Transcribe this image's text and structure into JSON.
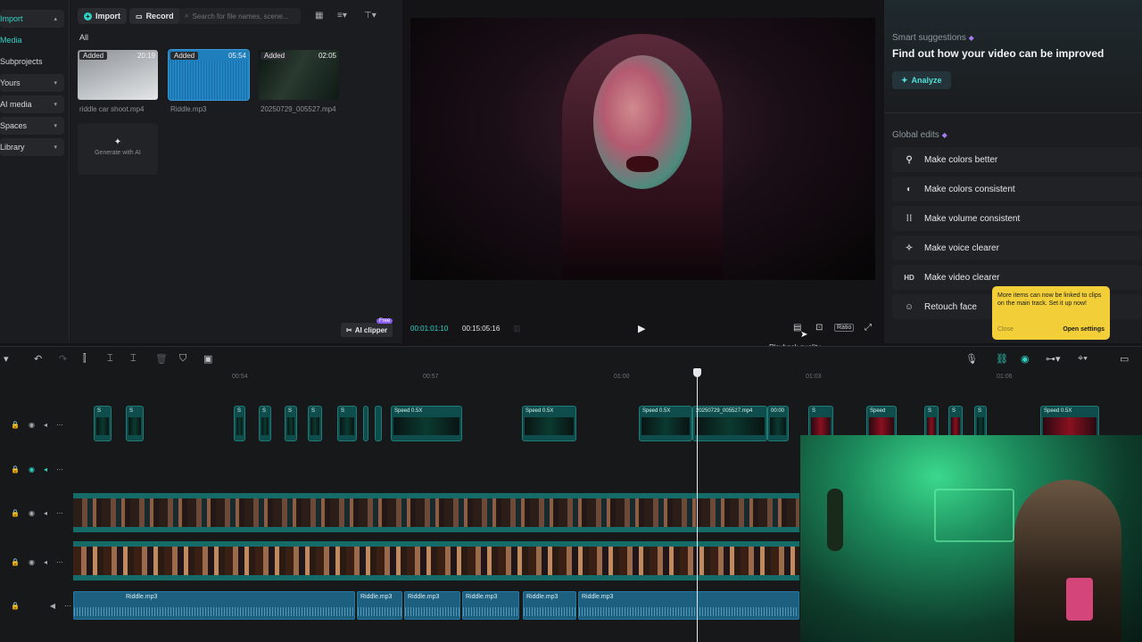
{
  "nav": {
    "items": [
      {
        "label": "Import"
      },
      {
        "label": "Media"
      },
      {
        "label": "Subprojects"
      },
      {
        "label": "Yours"
      },
      {
        "label": "AI media"
      },
      {
        "label": "Spaces"
      },
      {
        "label": "Library"
      }
    ]
  },
  "media": {
    "import_label": "Import",
    "record_label": "Record",
    "search_placeholder": "Search for file names, scene...",
    "filter_all": "All",
    "items": [
      {
        "badge": "Added",
        "duration": "20:19",
        "name": "riddle car shoot.mp4"
      },
      {
        "badge": "Added",
        "duration": "05:54",
        "name": "Riddle.mp3"
      },
      {
        "badge": "Added",
        "duration": "02:05",
        "name": "20250729_005527.mp4"
      }
    ],
    "generate_label": "Generate with AI",
    "ai_clipper_label": "AI clipper",
    "ai_clipper_badge": "Free"
  },
  "player": {
    "current_time": "00:01:01:10",
    "total_time": "00:15:05:16",
    "ratio_label": "Ratio",
    "playback_tooltip": "Playback quality"
  },
  "right_panel": {
    "smart_title": "Smart suggestions",
    "smart_heading": "Find out how your video can be improved",
    "analyze_label": "Analyze",
    "global_title": "Global edits",
    "items": [
      {
        "icon": "magic-wand-icon",
        "label": "Make colors better"
      },
      {
        "icon": "color-adjust-icon",
        "label": "Make colors consistent"
      },
      {
        "icon": "volume-sliders-icon",
        "label": "Make volume consistent"
      },
      {
        "icon": "voice-sparkle-icon",
        "label": "Make voice clearer"
      },
      {
        "icon": "hd-icon",
        "label": "Make video clearer"
      },
      {
        "icon": "face-retouch-icon",
        "label": "Retouch face"
      }
    ]
  },
  "tooltip": {
    "message": "More items can now be linked to clips on the main track. Set it up now!",
    "close_label": "Close",
    "settings_label": "Open settings"
  },
  "timeline": {
    "ruler": [
      "00:54",
      "00:57",
      "01:00",
      "01:03",
      "01:06"
    ],
    "clips": [
      {
        "label": "S"
      },
      {
        "label": "S"
      },
      {
        "label": "S"
      },
      {
        "label": "S"
      },
      {
        "label": "S"
      },
      {
        "label": "S"
      },
      {
        "label": "S"
      },
      {
        "label": "Speed 0.5X"
      },
      {
        "label": "Speed 0.5X"
      },
      {
        "label": "Speed 0.5X"
      },
      {
        "label": "20250729_005527.mp4"
      },
      {
        "label": "00:00"
      },
      {
        "label": "S"
      },
      {
        "label": "Speed"
      },
      {
        "label": "S"
      },
      {
        "label": "S"
      },
      {
        "label": "S"
      },
      {
        "label": "Speed 0.5X"
      }
    ],
    "audio_clips": [
      "Riddle.mp3",
      "Riddle.mp3",
      "Riddle.mp3",
      "Riddle.mp3",
      "Riddle.mp3",
      "Riddle.mp3"
    ]
  },
  "colors": {
    "accent": "#2fd3c6",
    "tooltip": "#f2cf39",
    "clip": "#0f4d4c",
    "audio": "#1d5f7e"
  }
}
